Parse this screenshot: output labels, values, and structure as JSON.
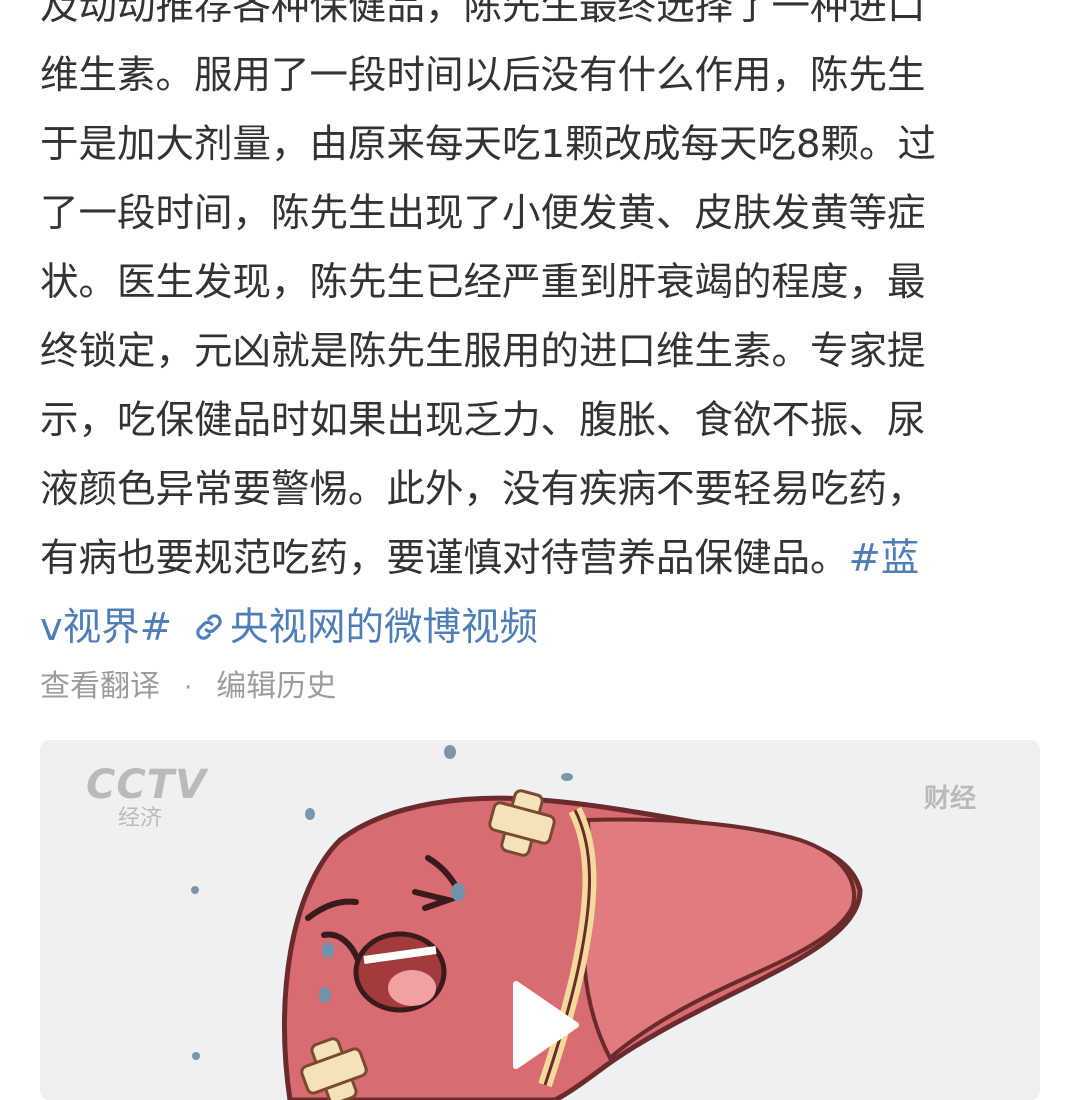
{
  "post": {
    "lines": [
      "及动动推荐各种保健品，陈先生最终选择了一种进口",
      "维生素。服用了一段时间以后没有什么作用，陈先生",
      "于是加大剂量，由原来每天吃1颗改成每天吃8颗。过",
      "了一段时间，陈先生出现了小便发黄、皮肤发黄等症",
      "状。医生发现，陈先生已经严重到肝衰竭的程度，最",
      "终锁定，元凶就是陈先生服用的进口维生素。专家提",
      "示，吃保健品时如果出现乏力、腹胀、食欲不振、尿",
      "液颜色异常要警惕。此外，没有疾病不要轻易吃药，"
    ],
    "last_line_text": "有病也要规范吃药，要谨慎对待营养品保健品。",
    "topic_part1": "#蓝",
    "topic_part2": "v视界#",
    "video_link_label": "央视网的微博视频",
    "link_color": "#4f7db6"
  },
  "meta": {
    "translate_label": "查看翻译",
    "separator": "·",
    "edit_history_label": "编辑历史"
  },
  "video": {
    "logo_text": "CCTV",
    "logo_sub_text": "经济",
    "channel_mark_text": "财经",
    "play_icon": "play-icon"
  }
}
